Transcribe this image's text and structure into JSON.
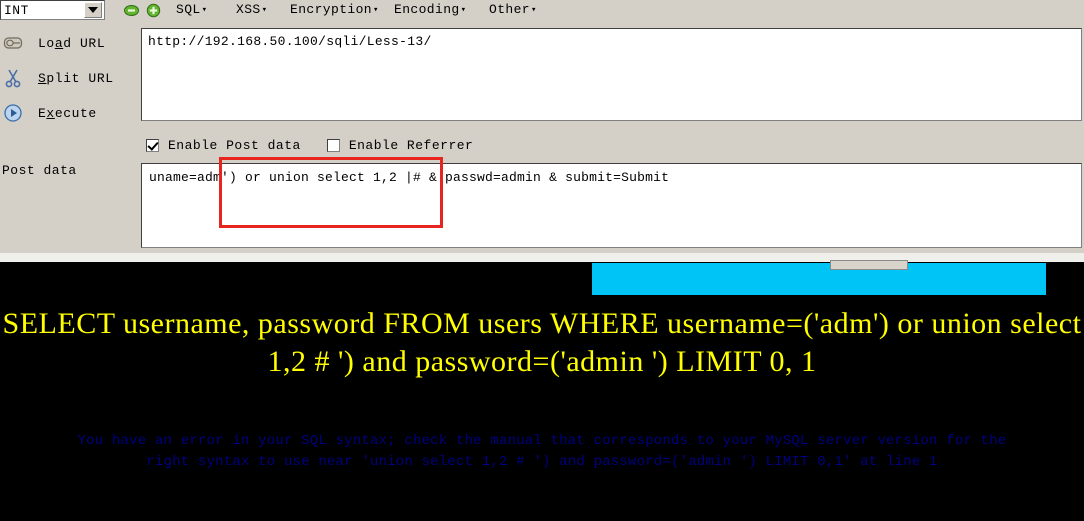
{
  "toolbar": {
    "type_select": {
      "value": "INT",
      "arrow_icon": "chevron-down-icon"
    },
    "minus_icon": "minus-circle-icon",
    "plus_icon": "plus-circle-icon",
    "menus": [
      {
        "label": "SQL",
        "caret": "▾"
      },
      {
        "label": "XSS",
        "caret": "▾"
      },
      {
        "label": "Encryption",
        "caret": "▾"
      },
      {
        "label": "Encoding",
        "caret": "▾"
      },
      {
        "label": "Other",
        "caret": "▾"
      }
    ]
  },
  "actions": [
    {
      "label_pre": "Lo",
      "label_key": "a",
      "label_post": "d URL",
      "icon": "load-url-icon"
    },
    {
      "label_pre": "",
      "label_key": "S",
      "label_post": "plit URL",
      "icon": "scissors-icon"
    },
    {
      "label_pre": "E",
      "label_key": "x",
      "label_post": "ecute",
      "icon": "play-circle-icon"
    }
  ],
  "url_field": {
    "value": "http://192.168.50.100/sqli/Less-13/",
    "placeholder": "http://"
  },
  "options": [
    {
      "label": "Enable Post data",
      "checked": true
    },
    {
      "label": "Enable Referrer",
      "checked": false
    }
  ],
  "post_data": {
    "label": "Post data",
    "value": "uname=adm') or union select 1,2 |# & passwd=admin & submit=Submit",
    "placeholder": "post data"
  },
  "annotation": {
    "name": "red-highlight-rectangle",
    "color": "#e8241f"
  },
  "output": {
    "cyan_bar_color": "#00c4f5",
    "sql_echo": "SELECT username, password FROM users WHERE username=('adm') or union select 1,2 # ') and password=('admin ') LIMIT 0, 1",
    "sql_echo_color": "#ffff00",
    "error_color": "#000080",
    "error_lines": [
      "You have an error in your SQL syntax; check the manual that corresponds to your MySQL server version for the",
      "right syntax to use near 'union select 1,2 # ') and password=('admin ') LIMIT 0,1' at line 1"
    ]
  }
}
